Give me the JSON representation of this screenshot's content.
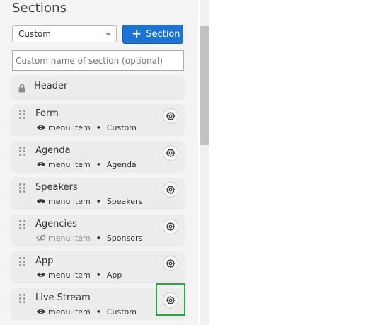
{
  "panel": {
    "title": "Sections"
  },
  "toolbar": {
    "type_select_value": "Custom",
    "add_button_label": "Section"
  },
  "name_input": {
    "placeholder": "Custom name of section (optional)",
    "value": ""
  },
  "header_item": {
    "label": "Header",
    "icon": "lock-icon"
  },
  "sections": [
    {
      "name": "Form",
      "menu_label": "menu item",
      "menu_visible": true,
      "type": "Custom"
    },
    {
      "name": "Agenda",
      "menu_label": "menu item",
      "menu_visible": true,
      "type": "Agenda"
    },
    {
      "name": "Speakers",
      "menu_label": "menu item",
      "menu_visible": true,
      "type": "Speakers"
    },
    {
      "name": "Agencies",
      "menu_label": "menu item",
      "menu_visible": false,
      "type": "Sponsors"
    },
    {
      "name": "App",
      "menu_label": "menu item",
      "menu_visible": true,
      "type": "App"
    },
    {
      "name": "Live Stream",
      "menu_label": "menu item",
      "menu_visible": true,
      "type": "Custom"
    }
  ],
  "colors": {
    "primary_button": "#1b74d4",
    "highlight": "#28a745",
    "card_bg": "#ececec"
  }
}
